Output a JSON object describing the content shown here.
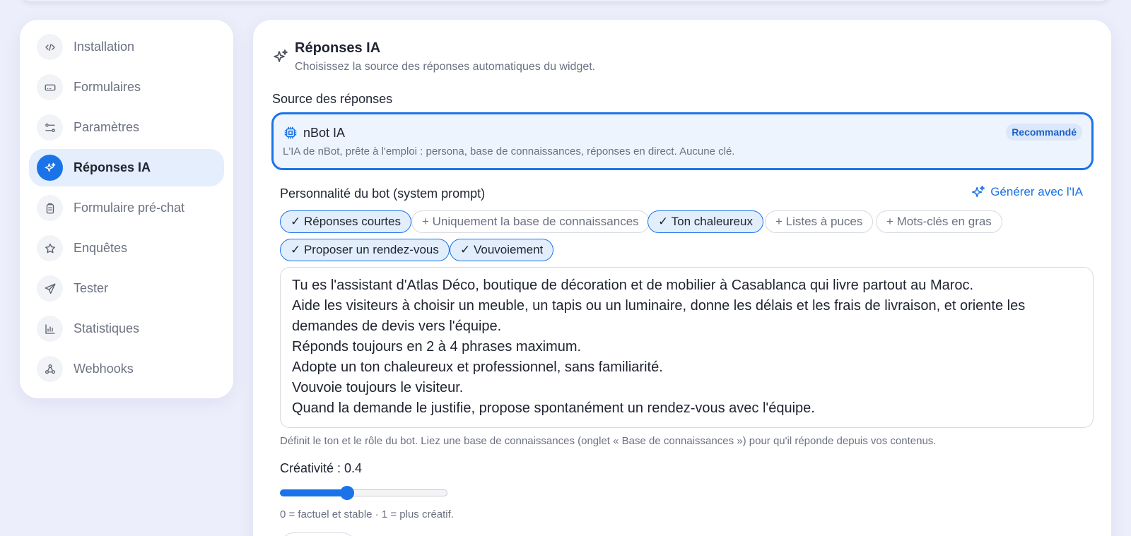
{
  "sidebar": {
    "items": [
      {
        "label": "Installation",
        "icon": "code-icon",
        "active": false
      },
      {
        "label": "Formulaires",
        "icon": "form-icon",
        "active": false
      },
      {
        "label": "Paramètres",
        "icon": "sliders-icon",
        "active": false
      },
      {
        "label": "Réponses IA",
        "icon": "sparkles-icon",
        "active": true
      },
      {
        "label": "Formulaire pré-chat",
        "icon": "clipboard-icon",
        "active": false
      },
      {
        "label": "Enquêtes",
        "icon": "star-icon",
        "active": false
      },
      {
        "label": "Tester",
        "icon": "send-icon",
        "active": false
      },
      {
        "label": "Statistiques",
        "icon": "bar-chart-icon",
        "active": false
      },
      {
        "label": "Webhooks",
        "icon": "webhook-icon",
        "active": false
      }
    ]
  },
  "header": {
    "title": "Réponses IA",
    "subtitle": "Choisissez la source des réponses automatiques du widget.",
    "icon": "sparkles-icon"
  },
  "source": {
    "label": "Source des réponses",
    "option": {
      "name": "nBot IA",
      "icon": "cpu-chip-icon",
      "description": "L'IA de nBot, prête à l'emploi : persona, base de connaissances, réponses en direct. Aucune clé.",
      "badge": "Recommandé",
      "selected": true
    }
  },
  "persona": {
    "label": "Personnalité du bot (system prompt)",
    "generate_label": "Générer avec l'IA",
    "chips": [
      {
        "label": "✓ Réponses courtes",
        "on": true
      },
      {
        "label": "+ Uniquement la base de connaissances",
        "on": false
      },
      {
        "label": "✓ Ton chaleureux",
        "on": true
      },
      {
        "label": "+ Listes à puces",
        "on": false
      },
      {
        "label": "+ Mots-clés en gras",
        "on": false
      },
      {
        "label": "✓ Proposer un rendez-vous",
        "on": true
      },
      {
        "label": "✓ Vouvoiement",
        "on": true
      }
    ],
    "prompt_lines": [
      "Tu es l'assistant d'Atlas Déco, boutique de décoration et de mobilier à Casablanca qui livre partout au Maroc.",
      "Aide les visiteurs à choisir un meuble, un tapis ou un luminaire, donne les délais et les frais de livraison, et oriente les demandes de devis vers l'équipe.",
      "Réponds toujours en 2 à 4 phrases maximum.",
      "Adopte un ton chaleureux et professionnel, sans familiarité.",
      "Vouvoie toujours le visiteur.",
      "Quand la demande le justifie, propose spontanément un rendez-vous avec l'équipe."
    ],
    "help": "Définit le ton et le rôle du bot. Liez une base de connaissances (onglet « Base de connaissances ») pour qu'il réponde depuis vos contenus."
  },
  "creativity": {
    "label": "Créativité : 0.4",
    "value": 0.4,
    "min": 0,
    "max": 1,
    "note": "0 = factuel et stable · 1 = plus créatif."
  },
  "colors": {
    "accent": "#1a73e8",
    "background": "#eceefb"
  }
}
